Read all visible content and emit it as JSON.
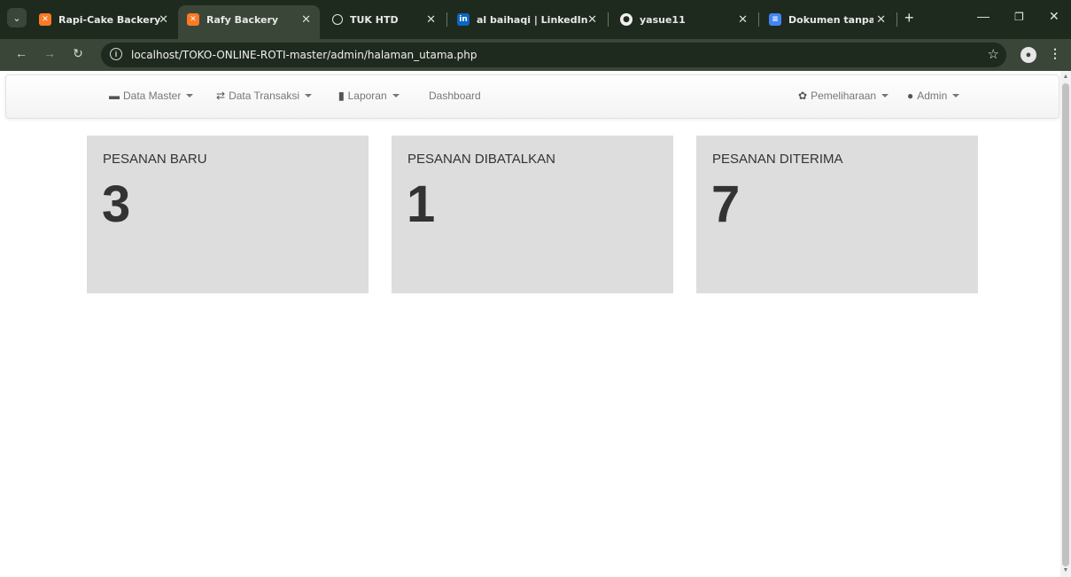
{
  "browser": {
    "tabs": [
      {
        "title": "Rapi-Cake Backery",
        "favicon": "xampp-icon",
        "active": false
      },
      {
        "title": "Rafy Backery",
        "favicon": "xampp-icon",
        "active": true
      },
      {
        "title": "TUK HTD",
        "favicon": "globe-icon",
        "active": false
      },
      {
        "title": "al baihaqi | LinkedIn",
        "favicon": "linkedin-icon",
        "active": false
      },
      {
        "title": "yasue11",
        "favicon": "github-icon",
        "active": false
      },
      {
        "title": "Dokumen tanpa judu",
        "favicon": "google-docs-icon",
        "active": false
      }
    ],
    "url": "localhost/TOKO-ONLINE-ROTI-master/admin/halaman_utama.php"
  },
  "navbar": {
    "items_left": [
      {
        "label": "Data Master",
        "icon": "folder-icon",
        "dropdown": true
      },
      {
        "label": "Data Transaksi",
        "icon": "retweet-icon",
        "dropdown": true
      },
      {
        "label": "Laporan",
        "icon": "stats-icon",
        "dropdown": true
      },
      {
        "label": "Dashboard",
        "icon": "",
        "dropdown": false
      }
    ],
    "items_right": [
      {
        "label": "Pemeliharaan",
        "icon": "cog-icon",
        "dropdown": true
      },
      {
        "label": "Admin",
        "icon": "user-icon",
        "dropdown": true
      }
    ]
  },
  "cards": [
    {
      "label": "PESANAN BARU",
      "value": "3"
    },
    {
      "label": "PESANAN DIBATALKAN",
      "value": "1"
    },
    {
      "label": "PESANAN DITERIMA",
      "value": "7"
    }
  ],
  "colors": {
    "tabbar_bg": "#1f2a1e",
    "toolbar_bg": "#3a4638",
    "card_bg": "#dddddd",
    "card_text": "#333333",
    "nav_text": "#777777"
  }
}
